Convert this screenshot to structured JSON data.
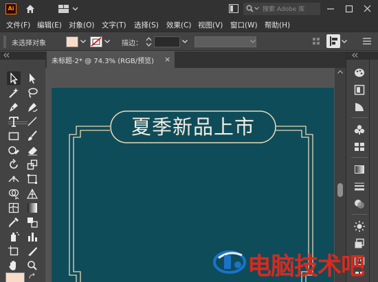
{
  "app": {
    "logo_text": "Ai",
    "search_placeholder": "搜索 Adobe 库"
  },
  "menu": {
    "items": [
      "文件(F)",
      "编辑(E)",
      "对象(O)",
      "文字(T)",
      "选择(S)",
      "效果(C)",
      "视图(V)",
      "窗口(W)",
      "帮助(H)"
    ]
  },
  "control_bar": {
    "selection_status": "未选择对象",
    "stroke_label": "描边：",
    "fill_color": "#f8dcc8",
    "stroke_width_value": ""
  },
  "document": {
    "tab_title": "未标题-2* @ 74.3% (RGB/预览)",
    "tab_close": "×",
    "artboard_color": "#0f4c5a"
  },
  "artwork": {
    "headline": "夏季新品上市",
    "line_color": "#e9d9b5",
    "text_color": "#f3ece0"
  },
  "watermark": {
    "text": "电脑技术吧",
    "color": "#d82a1e"
  },
  "tools": [
    "selection-tool",
    "direct-selection-tool",
    "magic-wand-tool",
    "lasso-tool",
    "pen-tool",
    "curvature-tool",
    "type-tool",
    "line-segment-tool",
    "rectangle-tool",
    "paintbrush-tool",
    "shaper-tool",
    "eraser-tool",
    "rotate-tool",
    "scale-tool",
    "width-tool",
    "free-transform-tool",
    "shape-builder-tool",
    "perspective-grid-tool",
    "mesh-tool",
    "gradient-tool",
    "eyedropper-tool",
    "blend-tool",
    "symbol-sprayer-tool",
    "column-graph-tool",
    "artboard-tool",
    "slice-tool",
    "hand-tool",
    "zoom-tool"
  ],
  "dock_panels": [
    "color-panel",
    "color-guide-panel",
    "swatches-panel",
    "symbols-panel",
    "brushes-panel",
    "graphic-styles-panel",
    "gradient-panel",
    "stroke-panel",
    "transparency-panel",
    "appearance-panel",
    "layers-panel",
    "asset-export-panel"
  ]
}
